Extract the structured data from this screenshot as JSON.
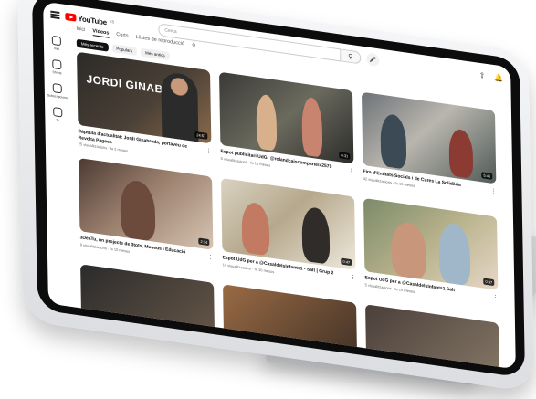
{
  "header": {
    "logo_text": "YouTube",
    "logo_sup": "ES",
    "search_placeholder": "Cerca",
    "search_icon": "search-icon",
    "mic_icon": "mic-icon",
    "upload_icon": "upload-icon",
    "bell_icon": "bell-icon"
  },
  "rail": {
    "items": [
      {
        "label": "Inici",
        "icon": "home-icon"
      },
      {
        "label": "Shorts",
        "icon": "shorts-icon"
      },
      {
        "label": "Subscripcions",
        "icon": "subscriptions-icon"
      },
      {
        "label": "Tu",
        "icon": "you-icon"
      }
    ]
  },
  "tabs": [
    {
      "label": "Inici",
      "active": false
    },
    {
      "label": "Vídeos",
      "active": true
    },
    {
      "label": "Curts",
      "active": false
    },
    {
      "label": "Llistes de reproducció",
      "active": false
    }
  ],
  "chips": [
    {
      "label": "Més recents",
      "active": true
    },
    {
      "label": "Populars",
      "active": false
    },
    {
      "label": "Més antics",
      "active": false
    }
  ],
  "videos": [
    {
      "title": "Càpsula d'actualitat: Jordi Ginabreda, portaveu de Revolta Pagesa",
      "meta": "25 visualitzacions · fa 2 mesos",
      "duration": "24:57",
      "overlay": "JORDI GINABREDA"
    },
    {
      "title": "Espot publicitari UdG: @rolandcaiscomparteix2579",
      "meta": "5 visualitzacions · fa 10 mesos",
      "duration": "0:31"
    },
    {
      "title": "Fira d'Entitats Socials i de Cures La Solidària",
      "meta": "42 visualitzacions · fa 10 mesos",
      "duration": "5:46"
    },
    {
      "title": "3DeaTu, un projecte de 3tots, Museus i Educació",
      "meta": "9 visualitzacions · fa 10 mesos",
      "duration": "2:14"
    },
    {
      "title": "Espot UdG per a @CasaldelsInfants1 - Salt | Grup 2",
      "meta": "14 visualitzacions · fa 10 mesos",
      "duration": "0:47"
    },
    {
      "title": "Espot UdG per a @CasaldelsInfants1 Salt",
      "meta": "5 visualitzacions · fa 10 mesos",
      "duration": "0:47"
    },
    {
      "title": "",
      "meta": "",
      "duration": ""
    },
    {
      "title": "",
      "meta": "",
      "duration": ""
    },
    {
      "title": "",
      "meta": "",
      "duration": ""
    }
  ]
}
